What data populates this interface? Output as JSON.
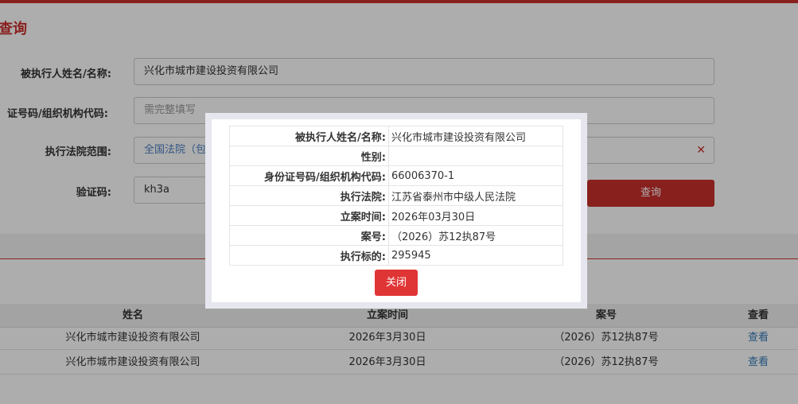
{
  "page": {
    "title": "查询"
  },
  "form": {
    "name_label": "被执行人姓名/名称:",
    "name_value": "兴化市城市建设投资有限公司",
    "id_label": "证号码/组织机构代码:",
    "id_placeholder": "需完整填写",
    "court_label": "执行法院范围:",
    "court_value": "全国法院（包",
    "clear_icon": "close-icon",
    "captcha_label": "验证码:",
    "captcha_value": "kh3a",
    "search_label": "查询"
  },
  "results": {
    "headers": [
      "姓名",
      "立案时间",
      "案号",
      "查看"
    ],
    "rows": [
      {
        "name": "兴化市城市建设投资有限公司",
        "date": "2026年3月30日",
        "case": "（2026）苏12执87号",
        "view": "查看"
      },
      {
        "name": "兴化市城市建设投资有限公司",
        "date": "2026年3月30日",
        "case": "（2026）苏12执87号",
        "view": "查看"
      }
    ]
  },
  "modal": {
    "rows": [
      {
        "label": "被执行人姓名/名称:",
        "value": "兴化市城市建设投资有限公司"
      },
      {
        "label": "性别:",
        "value": ""
      },
      {
        "label": "身份证号码/组织机构代码:",
        "value": "66006370-1"
      },
      {
        "label": "执行法院:",
        "value": "江苏省泰州市中级人民法院"
      },
      {
        "label": "立案时间:",
        "value": "2026年03月30日"
      },
      {
        "label": "案号:",
        "value": "（2026）苏12执87号"
      },
      {
        "label": "执行标的:",
        "value": "295945"
      }
    ],
    "close_label": "关闭"
  },
  "colors": {
    "accent": "#c9302c",
    "close_button": "#e03535",
    "link": "#337ab7"
  }
}
